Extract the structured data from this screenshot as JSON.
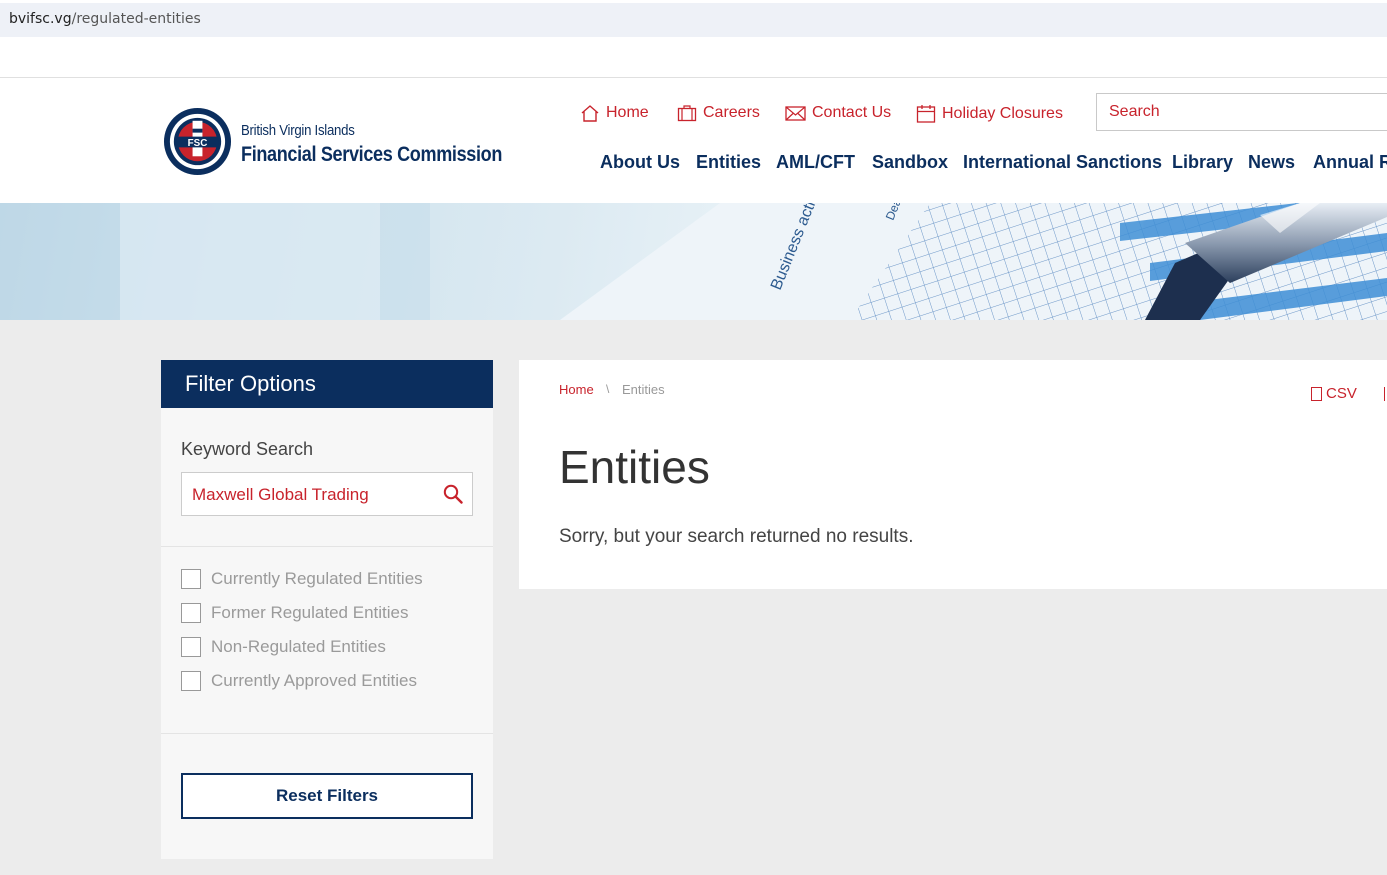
{
  "browser": {
    "domain": "bvifsc.vg",
    "path": "/regulated-entities"
  },
  "logo": {
    "line1": "British Virgin Islands",
    "line2": "Financial Services Commission",
    "seal_text": "FSC"
  },
  "utility_nav": [
    {
      "label": "Home",
      "icon": "home-icon"
    },
    {
      "label": "Careers",
      "icon": "briefcase-icon"
    },
    {
      "label": "Contact Us",
      "icon": "envelope-icon"
    },
    {
      "label": "Holiday Closures",
      "icon": "calendar-icon"
    }
  ],
  "search": {
    "placeholder": "Search"
  },
  "main_nav": [
    "About Us",
    "Entities",
    "AML/CFT",
    "Sandbox",
    "International Sanctions",
    "Library",
    "News",
    "Annual R"
  ],
  "banner": {
    "text1": "Business acti",
    "text2": "Dea"
  },
  "filter": {
    "title": "Filter Options",
    "keyword_label": "Keyword Search",
    "keyword_value": "Maxwell Global Trading",
    "options": [
      "Currently Regulated Entities",
      "Former Regulated Entities",
      "Non-Regulated Entities",
      "Currently Approved Entities"
    ],
    "reset_label": "Reset Filters"
  },
  "breadcrumb": {
    "home": "Home",
    "separator": "\\",
    "current": "Entities"
  },
  "export": {
    "csv": "CSV"
  },
  "main": {
    "title": "Entities",
    "message": "Sorry, but your search returned no results."
  },
  "colors": {
    "navy": "#0b2e5e",
    "red": "#c8232c",
    "bg": "#ececec"
  }
}
